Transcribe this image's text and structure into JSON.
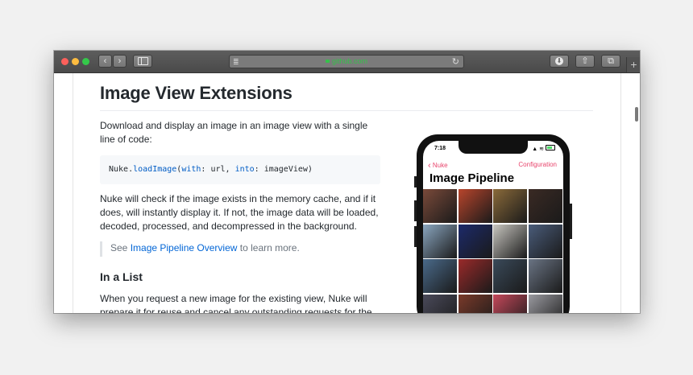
{
  "browser": {
    "url": "github.com",
    "new_tab_glyph": "+",
    "back_glyph": "‹",
    "forward_glyph": "›",
    "reload_glyph": "↻",
    "download_glyph": "⬇",
    "share_glyph": "⇧",
    "tabs_glyph": "⧉",
    "reader_glyph": "≣"
  },
  "article": {
    "title": "Image View Extensions",
    "intro": "Download and display an image in an image view with a single line of code:",
    "code": {
      "obj": "Nuke.",
      "fn": "loadImage",
      "open": "(",
      "with_kw": "with",
      "mid": ": url, ",
      "into_kw": "into",
      "end": ": imageView)"
    },
    "cache_paragraph": "Nuke will check if the image exists in the memory cache, and if it does, will instantly display it. If not, the image data will be loaded, decoded, processed, and decompressed in the background.",
    "quote_prefix": "See ",
    "quote_link": "Image Pipeline Overview",
    "quote_suffix": " to learn more.",
    "section_title": "In a List",
    "list_paragraph": "When you request a new image for the existing view, Nuke will prepare it for reuse and cancel any outstanding requests for the view."
  },
  "phone": {
    "time": "7:18",
    "status": "▲ ≋",
    "back_label": "Nuke",
    "back_chevron": "‹",
    "config_label": "Configuration",
    "title": "Image Pipeline",
    "tile_colors": [
      "#7a4a3a",
      "#b8452c",
      "#8a6a3a",
      "#3a2a24",
      "#8aa6c0",
      "#1c2a6a",
      "#c8c6c0",
      "#4a5c7a",
      "#4a6a8a",
      "#9a2a2a",
      "#3a4a5a",
      "#6a7484",
      "#4a4a5a",
      "#7a3a2a",
      "#c4485a",
      "#9a9aa0"
    ]
  },
  "colors": {
    "accent": "#e8446c",
    "link": "#0366d6",
    "url_green": "#35c14a"
  }
}
